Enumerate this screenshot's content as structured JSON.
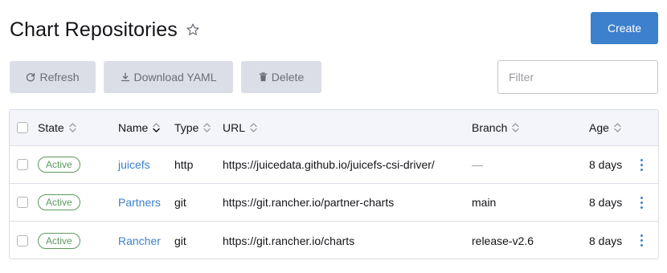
{
  "header": {
    "title": "Chart Repositories",
    "create_label": "Create"
  },
  "toolbar": {
    "refresh_label": "Refresh",
    "download_label": "Download YAML",
    "delete_label": "Delete"
  },
  "filter": {
    "placeholder": "Filter",
    "value": ""
  },
  "table": {
    "columns": {
      "state": "State",
      "name": "Name",
      "type": "Type",
      "url": "URL",
      "branch": "Branch",
      "age": "Age"
    },
    "rows": [
      {
        "state": "Active",
        "name": "juicefs",
        "type": "http",
        "url": "https://juicedata.github.io/juicefs-csi-driver/",
        "branch": "—",
        "age": "8 days"
      },
      {
        "state": "Active",
        "name": "Partners",
        "type": "git",
        "url": "https://git.rancher.io/partner-charts",
        "branch": "main",
        "age": "8 days"
      },
      {
        "state": "Active",
        "name": "Rancher",
        "type": "git",
        "url": "https://git.rancher.io/charts",
        "branch": "release-v2.6",
        "age": "8 days"
      }
    ]
  },
  "icons": {
    "favorite": "star-outline-icon",
    "refresh": "refresh-icon",
    "download": "download-icon",
    "delete": "trash-icon",
    "sort": "sort-icon",
    "row_actions": "kebab-menu-icon"
  },
  "colors": {
    "primary": "#3d80cc",
    "active_badge": "#5d995d",
    "bulk_button_bg": "#dcdee7",
    "table_header_bg": "#f4f5fa"
  }
}
